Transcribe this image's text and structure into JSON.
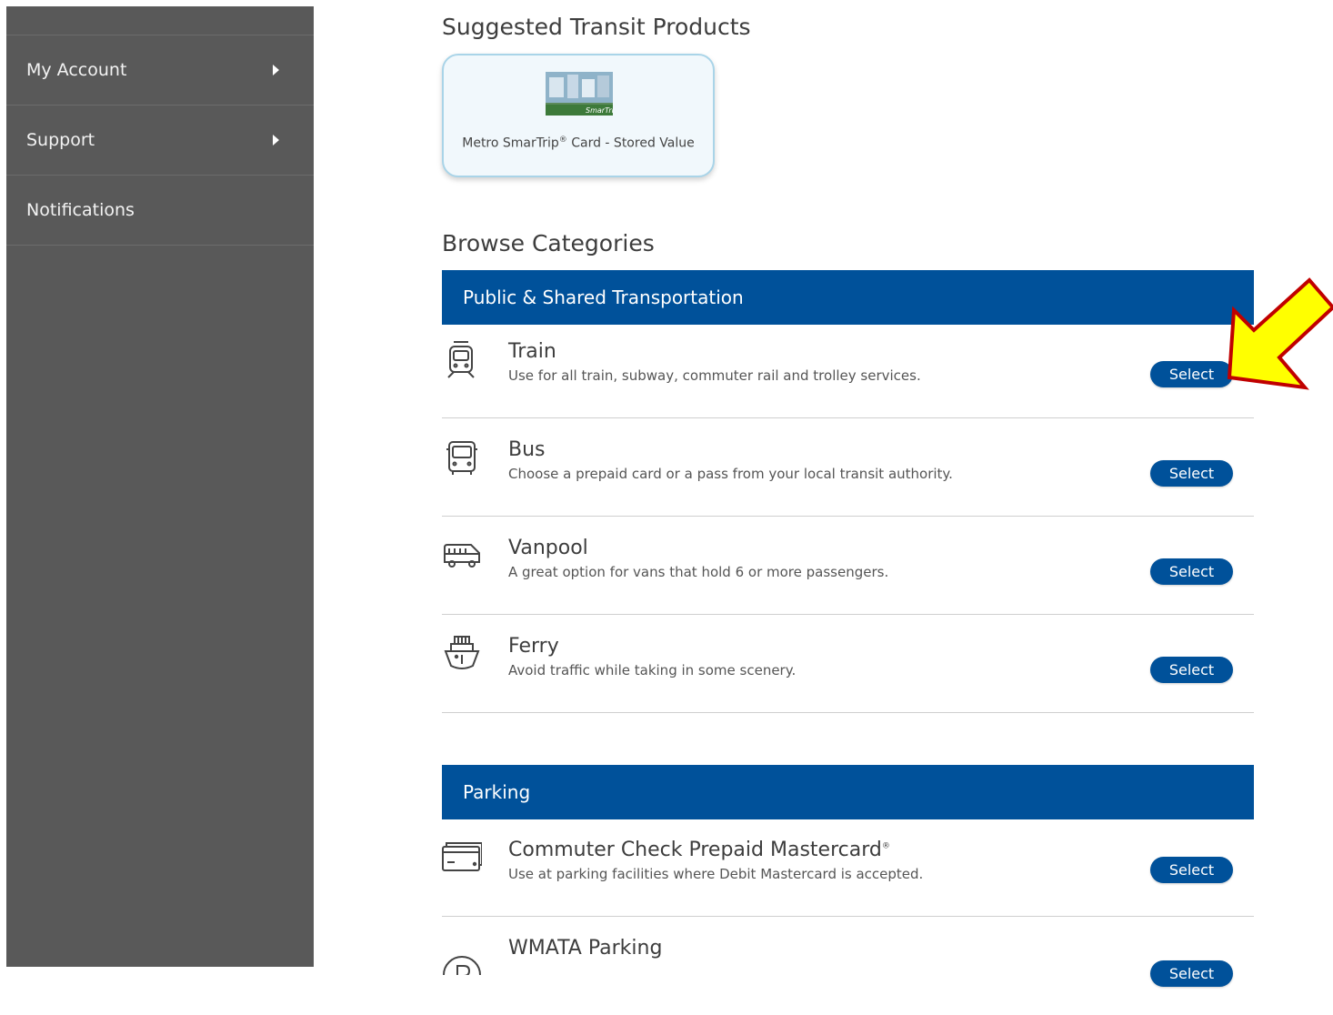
{
  "sidebar": {
    "items": [
      {
        "label": "My Account",
        "has_submenu": true
      },
      {
        "label": "Support",
        "has_submenu": true
      },
      {
        "label": "Notifications",
        "has_submenu": false
      }
    ]
  },
  "suggested": {
    "title": "Suggested Transit Products",
    "product": {
      "label_main": "Metro SmarTrip",
      "label_mark": "®",
      "label_rest": " Card - Stored Value",
      "image_text": "SmarTrip"
    }
  },
  "browse": {
    "title": "Browse Categories",
    "categories": [
      {
        "name": "Public & Shared Transportation",
        "items": [
          {
            "icon": "train-icon",
            "title": "Train",
            "description": "Use for all train, subway, commuter rail and trolley services.",
            "button": "Select"
          },
          {
            "icon": "bus-icon",
            "title": "Bus",
            "description": "Choose a prepaid card or a pass from your local transit authority.",
            "button": "Select"
          },
          {
            "icon": "van-icon",
            "title": "Vanpool",
            "description": "A great option for vans that hold 6 or more passengers.",
            "button": "Select"
          },
          {
            "icon": "ferry-icon",
            "title": "Ferry",
            "description": "Avoid traffic while taking in some scenery.",
            "button": "Select"
          }
        ]
      },
      {
        "name": "Parking",
        "items": [
          {
            "icon": "credit-card-icon",
            "title": "Commuter Check Prepaid Mastercard",
            "title_mark": "®",
            "description": "Use at parking facilities where Debit Mastercard is accepted.",
            "button": "Select"
          },
          {
            "icon": "parking-icon",
            "title": "WMATA Parking",
            "description": "",
            "button": "Select"
          }
        ]
      }
    ]
  },
  "colors": {
    "brand_blue": "#00519a",
    "sidebar_bg": "#595959",
    "highlight_arrow": "#ffff00",
    "arrow_outline": "#c00000"
  }
}
